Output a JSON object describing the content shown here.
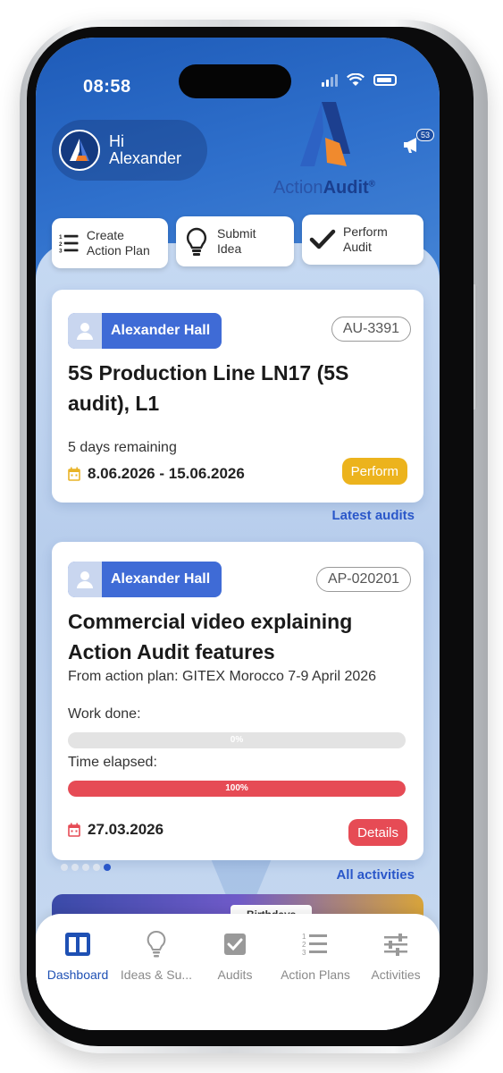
{
  "status_bar": {
    "time": "08:58"
  },
  "header": {
    "greeting": "Hi",
    "user_first_name": "Alexander",
    "brand_part1": "Action",
    "brand_part2": "Audit",
    "brand_mark": "®",
    "notification_count": "53"
  },
  "quick_actions": [
    {
      "label": "Create Action Plan",
      "icon": "numbered-list-icon"
    },
    {
      "label": "Submit Idea",
      "icon": "lightbulb-icon"
    },
    {
      "label": "Perform Audit",
      "icon": "checkmark-icon"
    }
  ],
  "audit_card": {
    "user": "Alexander Hall",
    "code": "AU-3391",
    "title": "5S Production Line LN17 (5S audit), L1",
    "remaining": "5 days remaining",
    "date_range": "8.06.2026 - 15.06.2026",
    "action_label": "Perform",
    "action_color": "#ecb31d"
  },
  "latest_audits_link": "Latest audits",
  "activity_card": {
    "user": "Alexander Hall",
    "code": "AP-020201",
    "title": "Commercial video explaining Action Audit features",
    "subtitle": "From action plan: GITEX Morocco 7-9 April 2026",
    "work_done_label": "Work done:",
    "work_done_value": 0,
    "work_done_text": "0%",
    "time_elapsed_label": "Time elapsed:",
    "time_elapsed_value": 100,
    "time_elapsed_text": "100%",
    "date": "27.03.2026",
    "action_label": "Details",
    "action_color": "#e64b55"
  },
  "carousel": {
    "total": 5,
    "active_index": 4
  },
  "all_activities_link": "All activities",
  "birthday_label": "Birthdays",
  "bottom_nav": [
    {
      "label": "Dashboard",
      "icon": "dashboard-icon",
      "active": true
    },
    {
      "label": "Ideas & Su...",
      "icon": "lightbulb-icon",
      "active": false
    },
    {
      "label": "Audits",
      "icon": "checkbox-icon",
      "active": false
    },
    {
      "label": "Action Plans",
      "icon": "numbered-list-icon",
      "active": false
    },
    {
      "label": "Activities",
      "icon": "sliders-icon",
      "active": false
    }
  ],
  "colors": {
    "accent_blue": "#3f6bd6",
    "link_blue": "#2a57c9",
    "progress_red": "#e64b55",
    "header_blue": "#2f70cc"
  }
}
